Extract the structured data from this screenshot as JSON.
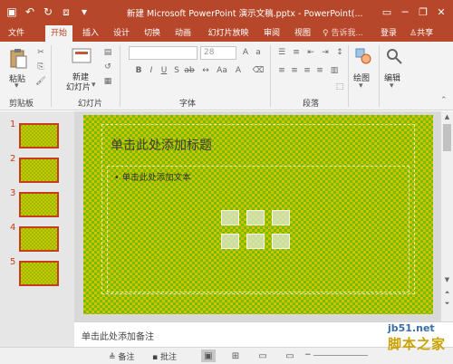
{
  "titlebar": {
    "title": "新建 Microsoft PowerPoint 演示文稿.pptx - PowerPoint(...",
    "qat_icons": [
      "save-icon",
      "undo-icon",
      "redo-icon",
      "customize-icon"
    ],
    "window_icons": [
      "ribbon-options-icon",
      "minimize-icon",
      "restore-icon",
      "close-icon"
    ]
  },
  "tabs": [
    {
      "label": "文件",
      "active": false
    },
    {
      "label": "开始",
      "active": true
    },
    {
      "label": "插入",
      "active": false
    },
    {
      "label": "设计",
      "active": false
    },
    {
      "label": "切换",
      "active": false
    },
    {
      "label": "动画",
      "active": false
    },
    {
      "label": "幻灯片放映",
      "active": false
    },
    {
      "label": "审阅",
      "active": false
    },
    {
      "label": "视图",
      "active": false
    }
  ],
  "tell_me": "♀ 告诉我...",
  "login": "登录",
  "share": "共享",
  "ribbon": {
    "paste": "粘贴",
    "new_slide_line1": "新建",
    "new_slide_line2": "幻灯片",
    "font_size": "28",
    "drawing": "绘图",
    "editing": "编辑",
    "groups": {
      "clipboard": "剪贴板",
      "slides": "幻灯片",
      "font": "字体",
      "paragraph": "段落"
    }
  },
  "slides": [
    {
      "number": "1"
    },
    {
      "number": "2"
    },
    {
      "number": "3"
    },
    {
      "number": "4"
    },
    {
      "number": "5"
    }
  ],
  "slide": {
    "title_placeholder": "单击此处添加标题",
    "body_placeholder": "• 单击此处添加文本"
  },
  "notes_placeholder": "单击此处添加备注",
  "statusbar": {
    "notes": "备注",
    "comments": "批注"
  },
  "watermark": {
    "site": "jb51.net",
    "brand": "脚本之家"
  },
  "colors": {
    "accent": "#b7472a",
    "slide_bg": "#6cc000",
    "thumb_border": "#c43e1c"
  }
}
